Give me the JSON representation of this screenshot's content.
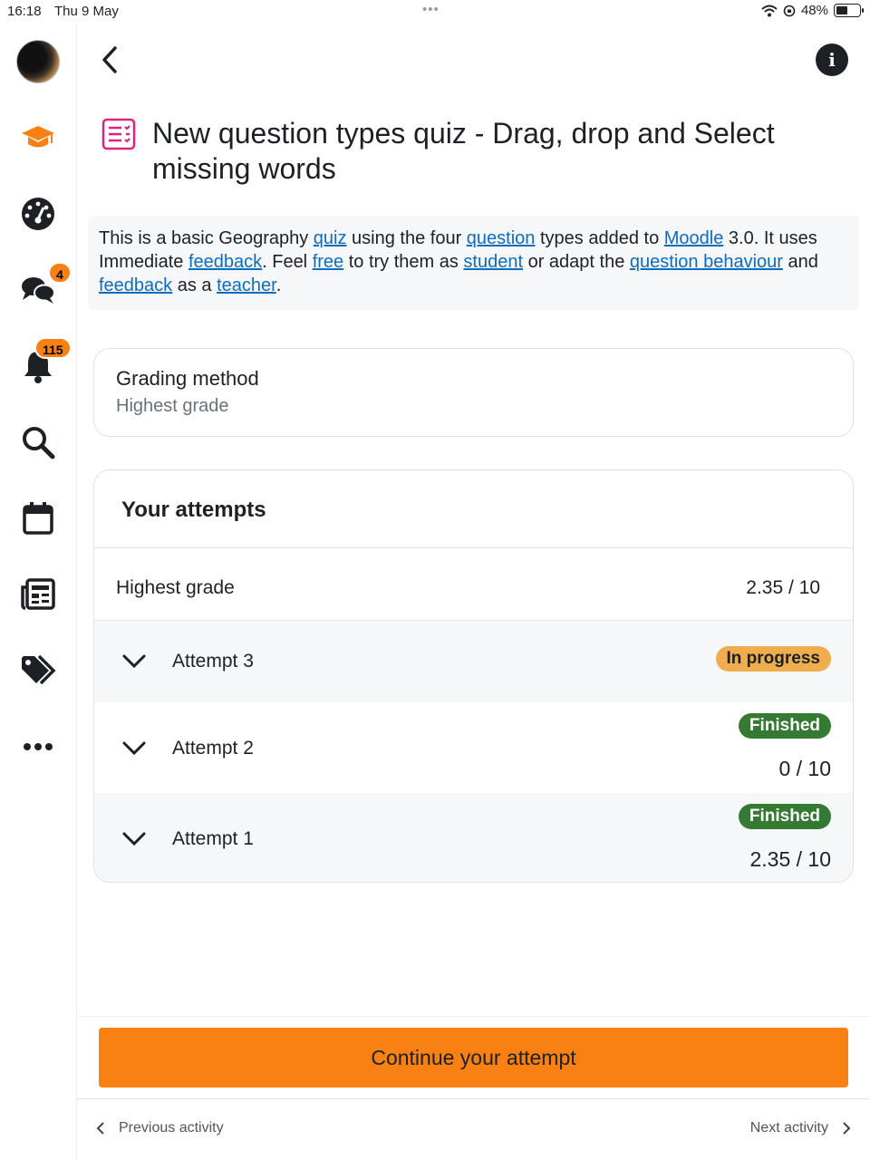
{
  "status_bar": {
    "time": "16:18",
    "date": "Thu 9 May",
    "battery": "48%"
  },
  "sidebar": {
    "messages_badge": "4",
    "notifications_badge": "115",
    "items": [
      "avatar",
      "my-courses",
      "dashboard",
      "messages",
      "notifications",
      "search",
      "calendar",
      "news",
      "tags",
      "more"
    ]
  },
  "page": {
    "title": "New question types quiz - Drag, drop and Select missing words",
    "intro": {
      "p1": "This is a basic Geography ",
      "l1": "quiz",
      "p2": " using the four ",
      "l2": "question",
      "p3": " types added to ",
      "l3": "Moodle",
      "p4": " 3.0. It uses Immediate ",
      "l4": "feedback",
      "p5": ". Feel ",
      "l5": "free",
      "p6": " to try them as ",
      "l6": "student",
      "p7": " or adapt the ",
      "l7": "question behaviour",
      "p8": " and ",
      "l8": "feedback",
      "p9": " as a ",
      "l9": "teacher",
      "p10": "."
    },
    "grading": {
      "label": "Grading method",
      "value": "Highest grade"
    },
    "attempts": {
      "heading": "Your attempts",
      "highest_label": "Highest grade",
      "highest_value": "2.35 / 10",
      "list": [
        {
          "label": "Attempt 3",
          "status": "In progress",
          "grade": ""
        },
        {
          "label": "Attempt 2",
          "status": "Finished",
          "grade": "0 / 10"
        },
        {
          "label": "Attempt 1",
          "status": "Finished",
          "grade": "2.35 / 10"
        }
      ]
    },
    "continue_button": "Continue your attempt",
    "prev_activity": "Previous activity",
    "next_activity": "Next activity"
  },
  "colors": {
    "accent": "#f98012",
    "link": "#0f6cbf",
    "finished": "#357a32",
    "in_progress": "#f0ad4e",
    "quiz_icon": "#e0237d"
  }
}
